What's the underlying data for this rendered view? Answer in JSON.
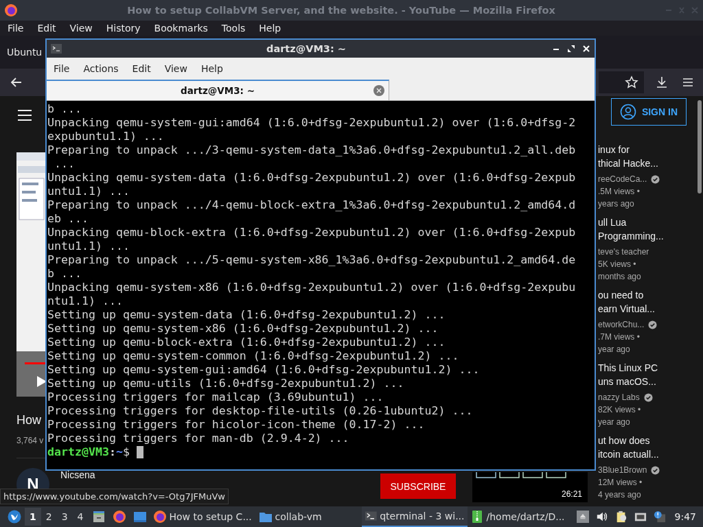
{
  "browser": {
    "title": "How to setup CollabVM Server, and the website. - YouTube — Mozilla Firefox",
    "menu": [
      "File",
      "Edit",
      "View",
      "History",
      "Bookmarks",
      "Tools",
      "Help"
    ],
    "tab_label": "Ubuntu",
    "page": {
      "video_title": "How",
      "video_views": "3,764 v",
      "channel": "Nicsena",
      "avatar_letter": "N",
      "subscribe": "SUBSCRIBE",
      "sign_in": "SIGN IN",
      "recommendations": [
        {
          "title_lines": [
            "inux for",
            "thical Hacke..."
          ],
          "channel": "reeCodeCa...",
          "verified": true,
          "views": ".5M views •",
          "age": "years ago"
        },
        {
          "title_lines": [
            "ull Lua",
            "Programming..."
          ],
          "channel": "teve's teacher",
          "verified": false,
          "views": "5K views •",
          "age": "months ago"
        },
        {
          "title_lines": [
            "ou need to",
            "earn Virtual..."
          ],
          "channel": "etworkChu...",
          "verified": true,
          "views": ".7M views •",
          "age": "year ago"
        },
        {
          "title_lines": [
            "This Linux PC",
            "uns macOS..."
          ],
          "channel": "nazzy Labs",
          "verified": true,
          "views": "82K views •",
          "age": "year ago"
        },
        {
          "title_lines": [
            "ut how does",
            "itcoin actuall..."
          ],
          "channel": "3Blue1Brown",
          "verified": true,
          "views": "12M views •",
          "age": "4 years ago",
          "thumbnail": {
            "kind": "picture",
            "duration": "26:21"
          }
        }
      ]
    },
    "link_tooltip": "https://www.youtube.com/watch?v=-Otg7JFMuVw"
  },
  "terminal": {
    "title": "dartz@VM3: ~",
    "menu": [
      "File",
      "Actions",
      "Edit",
      "View",
      "Help"
    ],
    "tabs": [
      {
        "label": "dartz@VM3: ~",
        "selected": true
      }
    ],
    "lines": [
      "b ...",
      "Unpacking qemu-system-gui:amd64 (1:6.0+dfsg-2expubuntu1.2) over (1:6.0+dfsg-2",
      "expubuntu1.1) ...",
      "Preparing to unpack .../3-qemu-system-data_1%3a6.0+dfsg-2expubuntu1.2_all.deb",
      " ...",
      "Unpacking qemu-system-data (1:6.0+dfsg-2expubuntu1.2) over (1:6.0+dfsg-2expub",
      "untu1.1) ...",
      "Preparing to unpack .../4-qemu-block-extra_1%3a6.0+dfsg-2expubuntu1.2_amd64.d",
      "eb ...",
      "Unpacking qemu-block-extra (1:6.0+dfsg-2expubuntu1.2) over (1:6.0+dfsg-2expub",
      "untu1.1) ...",
      "Preparing to unpack .../5-qemu-system-x86_1%3a6.0+dfsg-2expubuntu1.2_amd64.de",
      "b ...",
      "Unpacking qemu-system-x86 (1:6.0+dfsg-2expubuntu1.2) over (1:6.0+dfsg-2expubu",
      "ntu1.1) ...",
      "Setting up qemu-system-data (1:6.0+dfsg-2expubuntu1.2) ...",
      "Setting up qemu-system-x86 (1:6.0+dfsg-2expubuntu1.2) ...",
      "Setting up qemu-block-extra (1:6.0+dfsg-2expubuntu1.2) ...",
      "Setting up qemu-system-common (1:6.0+dfsg-2expubuntu1.2) ...",
      "Setting up qemu-system-gui:amd64 (1:6.0+dfsg-2expubuntu1.2) ...",
      "Setting up qemu-utils (1:6.0+dfsg-2expubuntu1.2) ...",
      "Processing triggers for mailcap (3.69ubuntu1) ...",
      "Processing triggers for desktop-file-utils (0.26-1ubuntu2) ...",
      "Processing triggers for hicolor-icon-theme (0.17-2) ...",
      "Processing triggers for man-db (2.9.4-2) ..."
    ],
    "prompt": {
      "user_host": "dartz@VM3",
      "separator": ":",
      "path": "~",
      "symbol": "$"
    }
  },
  "taskbar": {
    "workspaces": [
      {
        "label": "1",
        "selected": true
      },
      {
        "label": "2",
        "selected": false
      },
      {
        "label": "3",
        "selected": false
      },
      {
        "label": "4",
        "selected": false
      }
    ],
    "tasks": [
      {
        "label": "How to setup C...",
        "kind": "browser",
        "selected": false
      },
      {
        "label": "collab-vm",
        "kind": "folder",
        "selected": false
      },
      {
        "label": "qterminal - 3 wi...",
        "kind": "terminal",
        "selected": true
      },
      {
        "label": "/home/dartz/D...",
        "kind": "archive",
        "selected": false
      }
    ],
    "clock": "9:47"
  }
}
